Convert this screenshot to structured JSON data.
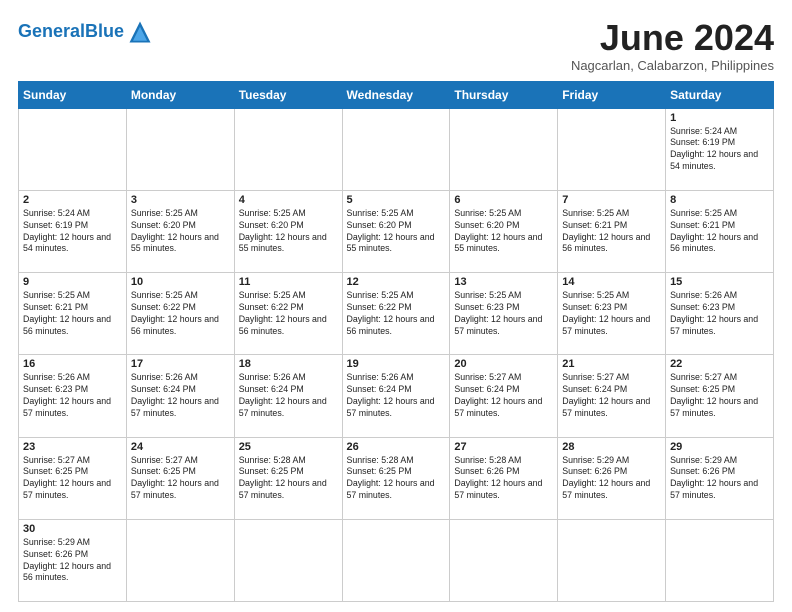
{
  "header": {
    "logo_general": "General",
    "logo_blue": "Blue",
    "month": "June 2024",
    "location": "Nagcarlan, Calabarzon, Philippines"
  },
  "days": [
    "Sunday",
    "Monday",
    "Tuesday",
    "Wednesday",
    "Thursday",
    "Friday",
    "Saturday"
  ],
  "weeks": [
    [
      {
        "num": "",
        "info": "",
        "empty": true
      },
      {
        "num": "",
        "info": "",
        "empty": true
      },
      {
        "num": "",
        "info": "",
        "empty": true
      },
      {
        "num": "",
        "info": "",
        "empty": true
      },
      {
        "num": "",
        "info": "",
        "empty": true
      },
      {
        "num": "",
        "info": "",
        "empty": true
      },
      {
        "num": "1",
        "info": "Sunrise: 5:24 AM\nSunset: 6:19 PM\nDaylight: 12 hours\nand 54 minutes.",
        "empty": false
      }
    ],
    [
      {
        "num": "2",
        "info": "Sunrise: 5:24 AM\nSunset: 6:19 PM\nDaylight: 12 hours\nand 54 minutes.",
        "empty": false
      },
      {
        "num": "3",
        "info": "Sunrise: 5:25 AM\nSunset: 6:20 PM\nDaylight: 12 hours\nand 55 minutes.",
        "empty": false
      },
      {
        "num": "4",
        "info": "Sunrise: 5:25 AM\nSunset: 6:20 PM\nDaylight: 12 hours\nand 55 minutes.",
        "empty": false
      },
      {
        "num": "5",
        "info": "Sunrise: 5:25 AM\nSunset: 6:20 PM\nDaylight: 12 hours\nand 55 minutes.",
        "empty": false
      },
      {
        "num": "6",
        "info": "Sunrise: 5:25 AM\nSunset: 6:20 PM\nDaylight: 12 hours\nand 55 minutes.",
        "empty": false
      },
      {
        "num": "7",
        "info": "Sunrise: 5:25 AM\nSunset: 6:21 PM\nDaylight: 12 hours\nand 56 minutes.",
        "empty": false
      },
      {
        "num": "8",
        "info": "Sunrise: 5:25 AM\nSunset: 6:21 PM\nDaylight: 12 hours\nand 56 minutes.",
        "empty": false
      }
    ],
    [
      {
        "num": "9",
        "info": "Sunrise: 5:25 AM\nSunset: 6:21 PM\nDaylight: 12 hours\nand 56 minutes.",
        "empty": false
      },
      {
        "num": "10",
        "info": "Sunrise: 5:25 AM\nSunset: 6:22 PM\nDaylight: 12 hours\nand 56 minutes.",
        "empty": false
      },
      {
        "num": "11",
        "info": "Sunrise: 5:25 AM\nSunset: 6:22 PM\nDaylight: 12 hours\nand 56 minutes.",
        "empty": false
      },
      {
        "num": "12",
        "info": "Sunrise: 5:25 AM\nSunset: 6:22 PM\nDaylight: 12 hours\nand 56 minutes.",
        "empty": false
      },
      {
        "num": "13",
        "info": "Sunrise: 5:25 AM\nSunset: 6:23 PM\nDaylight: 12 hours\nand 57 minutes.",
        "empty": false
      },
      {
        "num": "14",
        "info": "Sunrise: 5:25 AM\nSunset: 6:23 PM\nDaylight: 12 hours\nand 57 minutes.",
        "empty": false
      },
      {
        "num": "15",
        "info": "Sunrise: 5:26 AM\nSunset: 6:23 PM\nDaylight: 12 hours\nand 57 minutes.",
        "empty": false
      }
    ],
    [
      {
        "num": "16",
        "info": "Sunrise: 5:26 AM\nSunset: 6:23 PM\nDaylight: 12 hours\nand 57 minutes.",
        "empty": false
      },
      {
        "num": "17",
        "info": "Sunrise: 5:26 AM\nSunset: 6:24 PM\nDaylight: 12 hours\nand 57 minutes.",
        "empty": false
      },
      {
        "num": "18",
        "info": "Sunrise: 5:26 AM\nSunset: 6:24 PM\nDaylight: 12 hours\nand 57 minutes.",
        "empty": false
      },
      {
        "num": "19",
        "info": "Sunrise: 5:26 AM\nSunset: 6:24 PM\nDaylight: 12 hours\nand 57 minutes.",
        "empty": false
      },
      {
        "num": "20",
        "info": "Sunrise: 5:27 AM\nSunset: 6:24 PM\nDaylight: 12 hours\nand 57 minutes.",
        "empty": false
      },
      {
        "num": "21",
        "info": "Sunrise: 5:27 AM\nSunset: 6:24 PM\nDaylight: 12 hours\nand 57 minutes.",
        "empty": false
      },
      {
        "num": "22",
        "info": "Sunrise: 5:27 AM\nSunset: 6:25 PM\nDaylight: 12 hours\nand 57 minutes.",
        "empty": false
      }
    ],
    [
      {
        "num": "23",
        "info": "Sunrise: 5:27 AM\nSunset: 6:25 PM\nDaylight: 12 hours\nand 57 minutes.",
        "empty": false
      },
      {
        "num": "24",
        "info": "Sunrise: 5:27 AM\nSunset: 6:25 PM\nDaylight: 12 hours\nand 57 minutes.",
        "empty": false
      },
      {
        "num": "25",
        "info": "Sunrise: 5:28 AM\nSunset: 6:25 PM\nDaylight: 12 hours\nand 57 minutes.",
        "empty": false
      },
      {
        "num": "26",
        "info": "Sunrise: 5:28 AM\nSunset: 6:25 PM\nDaylight: 12 hours\nand 57 minutes.",
        "empty": false
      },
      {
        "num": "27",
        "info": "Sunrise: 5:28 AM\nSunset: 6:26 PM\nDaylight: 12 hours\nand 57 minutes.",
        "empty": false
      },
      {
        "num": "28",
        "info": "Sunrise: 5:29 AM\nSunset: 6:26 PM\nDaylight: 12 hours\nand 57 minutes.",
        "empty": false
      },
      {
        "num": "29",
        "info": "Sunrise: 5:29 AM\nSunset: 6:26 PM\nDaylight: 12 hours\nand 57 minutes.",
        "empty": false
      }
    ],
    [
      {
        "num": "30",
        "info": "Sunrise: 5:29 AM\nSunset: 6:26 PM\nDaylight: 12 hours\nand 56 minutes.",
        "empty": false
      },
      {
        "num": "",
        "info": "",
        "empty": true
      },
      {
        "num": "",
        "info": "",
        "empty": true
      },
      {
        "num": "",
        "info": "",
        "empty": true
      },
      {
        "num": "",
        "info": "",
        "empty": true
      },
      {
        "num": "",
        "info": "",
        "empty": true
      },
      {
        "num": "",
        "info": "",
        "empty": true
      }
    ]
  ]
}
